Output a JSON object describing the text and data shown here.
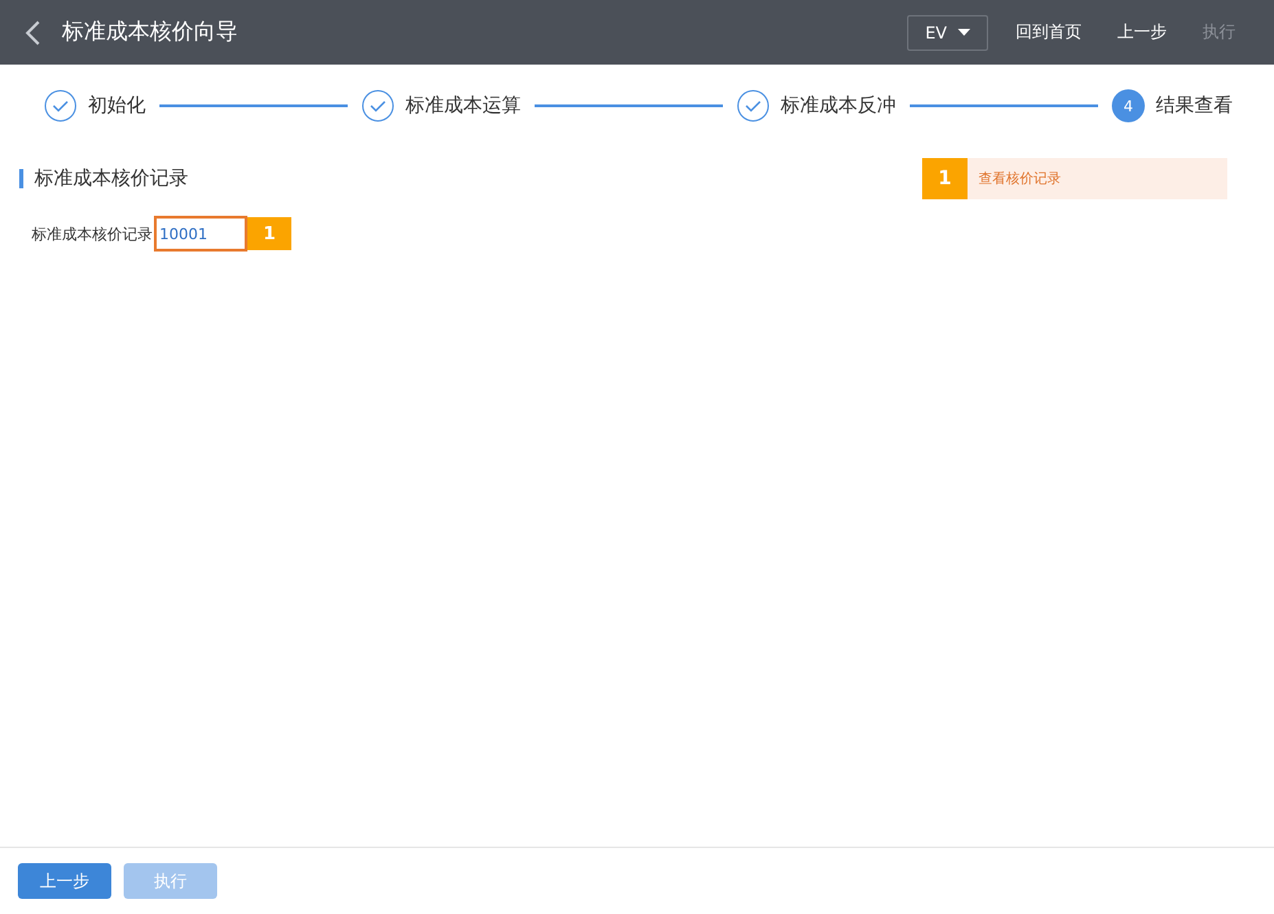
{
  "header": {
    "title": "标准成本核价向导",
    "dropdown": "EV",
    "actions": [
      {
        "label": "回到首页",
        "disabled": false
      },
      {
        "label": "上一步",
        "disabled": false
      },
      {
        "label": "执行",
        "disabled": true
      }
    ]
  },
  "steps": [
    {
      "label": "初始化",
      "kind": "done"
    },
    {
      "label": "标准成本运算",
      "kind": "done"
    },
    {
      "label": "标准成本反冲",
      "kind": "done"
    },
    {
      "label": "结果查看",
      "kind": "current",
      "number": "4"
    }
  ],
  "section": {
    "title": "标准成本核价记录",
    "field_label": "标准成本核价记录",
    "field_value": "10001",
    "field_badge": "1"
  },
  "callout": {
    "badge": "1",
    "text": "查看核价记录"
  },
  "footer": {
    "buttons": [
      {
        "label": "上一步",
        "disabled": false
      },
      {
        "label": "执行",
        "disabled": true
      }
    ]
  }
}
